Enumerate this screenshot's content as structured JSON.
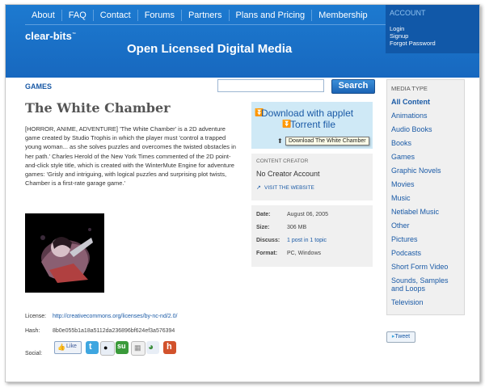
{
  "nav": [
    "About",
    "FAQ",
    "Contact",
    "Forums",
    "Partners",
    "Plans and Pricing",
    "Membership"
  ],
  "account": {
    "title": "ACCOUNT",
    "login": "Login",
    "signup": "Signup",
    "forgot": "Forgot Password"
  },
  "site": {
    "logo": "clear-bits",
    "logo_mark": "™",
    "tagline": "Open Licensed Digital Media"
  },
  "section_label": "GAMES",
  "search": {
    "placeholder": "",
    "button": "Search"
  },
  "media": {
    "title": "The White Chamber",
    "description": "[HORROR, ANIME, ADVENTURE] 'The White Chamber' is a 2D adventure game created by Studio Trophis in which the player must 'control a trapped young woman... as she solves puzzles and overcomes the twisted obstacles in her path.' Charles Herold of the New York Times commented of the 2D point-and-click style title, which is created with the WinterMute Engine for adventure games: 'Grisly and intriguing, with logical puzzles and surprising plot twists, Chamber is a first-rate garage game.'"
  },
  "meta": {
    "license_label": "License:",
    "license_value": "http://creativecommons.org/licenses/by-nc-nd/2.0/",
    "hash_label": "Hash:",
    "hash_value": "8b0e055b1a18a5112da236896bf624ef3a576394",
    "social_label": "Social:",
    "like": "Like"
  },
  "download": {
    "applet": "Download with applet",
    "torrent": "Torrent file",
    "stats_seeds": "0",
    "stats_peers": "33594",
    "tooltip": "Download The White Chamber"
  },
  "creator": {
    "label": "CONTENT CREATOR",
    "name": "No Creator Account",
    "visit": "VISIT THE WEBSITE"
  },
  "info": {
    "date_label": "Date:",
    "date": "August 06, 2005",
    "size_label": "Size:",
    "size": "306 MB",
    "discuss_label": "Discuss:",
    "discuss": "1 post in 1 topic",
    "format_label": "Format:",
    "format": "PC, Windows"
  },
  "sidebar": {
    "title": "MEDIA TYPE",
    "items": [
      "All Content",
      "Animations",
      "Audio Books",
      "Books",
      "Games",
      "Graphic Novels",
      "Movies",
      "Music",
      "Netlabel Music",
      "Other",
      "Pictures",
      "Podcasts",
      "Short Form Video",
      "Sounds, Samples and Loops",
      "Television"
    ]
  },
  "tweet": "Tweet",
  "colors": {
    "brand_blue": "#1768bf",
    "account_bg": "#1158a8",
    "link": "#1a5aa6",
    "download_bg": "#cfe9f6"
  }
}
